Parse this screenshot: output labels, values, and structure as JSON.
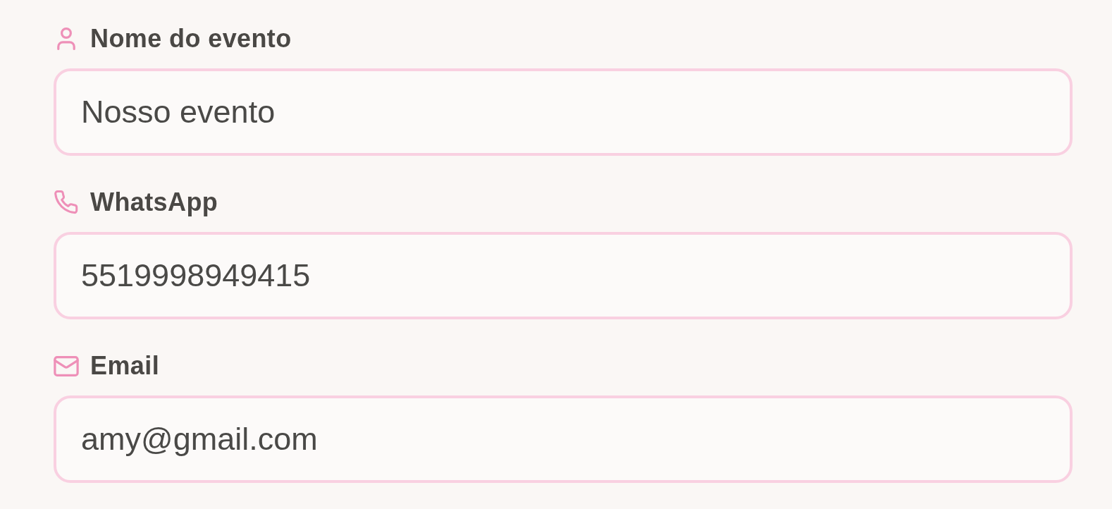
{
  "fields": [
    {
      "kind": "name",
      "label": "Nome do evento",
      "value": "Nosso evento"
    },
    {
      "kind": "phone",
      "label": "WhatsApp",
      "value": "5519998949415"
    },
    {
      "kind": "email",
      "label": "Email",
      "value": "amy@gmail.com"
    }
  ]
}
